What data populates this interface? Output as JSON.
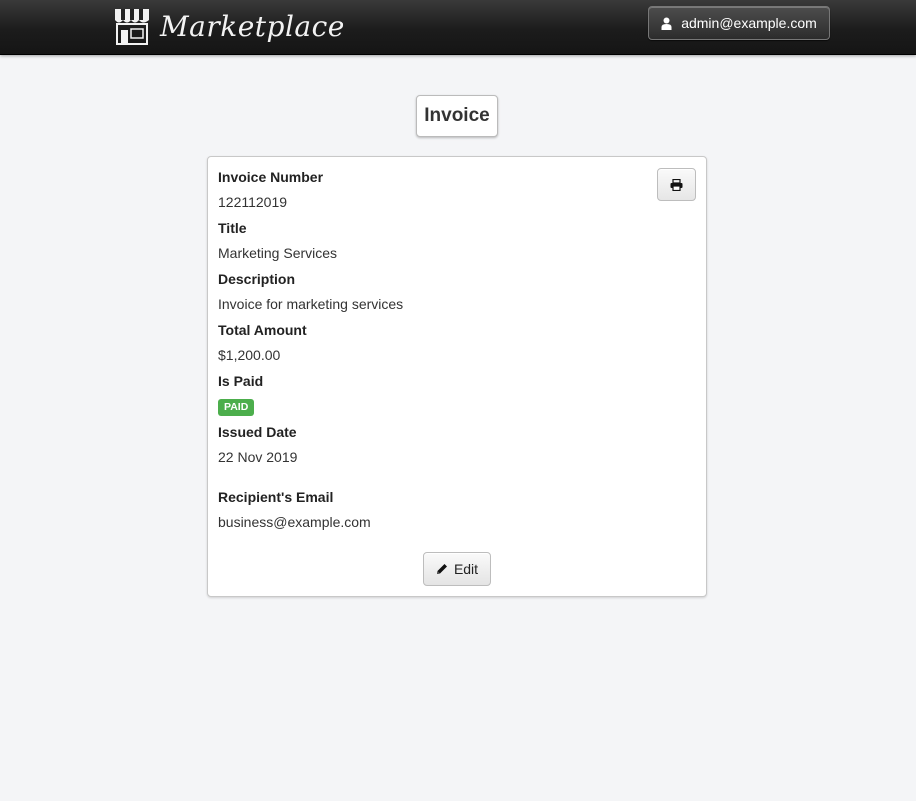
{
  "header": {
    "brand": "Marketplace",
    "brand_icon": "storefront-icon",
    "user_email": "admin@example.com",
    "user_icon": "user-icon"
  },
  "page": {
    "title": "Invoice"
  },
  "invoice": {
    "fields": [
      {
        "label": "Invoice Number",
        "value": "122112019"
      },
      {
        "label": "Title",
        "value": "Marketing Services"
      },
      {
        "label": "Description",
        "value": "Invoice for marketing services"
      },
      {
        "label": "Total Amount",
        "value": "$1,200.00"
      },
      {
        "label": "Is Paid",
        "value": "PAID"
      },
      {
        "label": "Issued Date",
        "value": "22 Nov 2019"
      },
      {
        "label": "Recipient's Email",
        "value": "business@example.com"
      }
    ],
    "paid_badge_color": "#4cae4c",
    "print_icon": "print-icon",
    "edit_label": "Edit",
    "edit_icon": "pencil-icon"
  }
}
